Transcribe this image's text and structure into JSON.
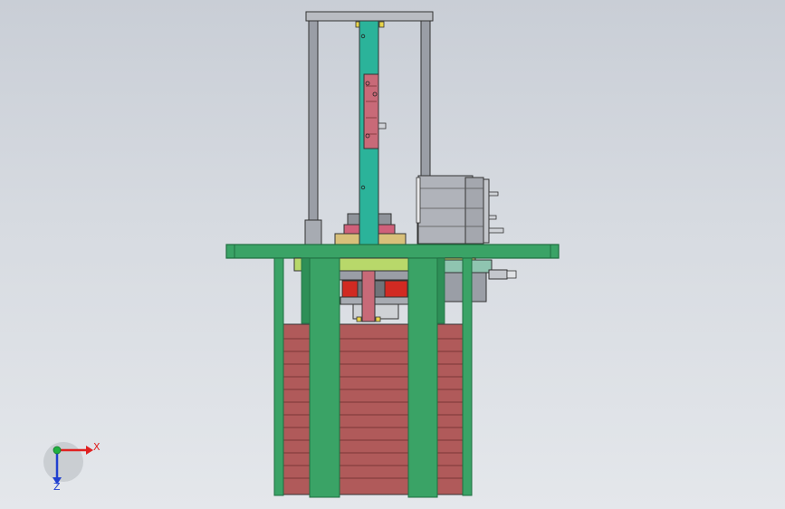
{
  "viewport": {
    "background_top": "#c9ced6",
    "background_bottom": "#e4e7eb"
  },
  "model": {
    "colors": {
      "frame_green": "#3aa366",
      "frame_green_dark": "#1f6e40",
      "column_teal": "#2bb39a",
      "brick_red": "#b05a5a",
      "brick_line": "#7a3535",
      "pink_block": "#d0607a",
      "red_gear": "#d12a22",
      "steel_grey": "#9a9ea6",
      "motor_grey": "#b0b3ba",
      "brass": "#d8c07a",
      "lime": "#b8d86a"
    }
  },
  "triad": {
    "x_label": "X",
    "z_label": "Z",
    "x_color": "#e02020",
    "y_color": "#20b040",
    "z_color": "#2040d0"
  }
}
